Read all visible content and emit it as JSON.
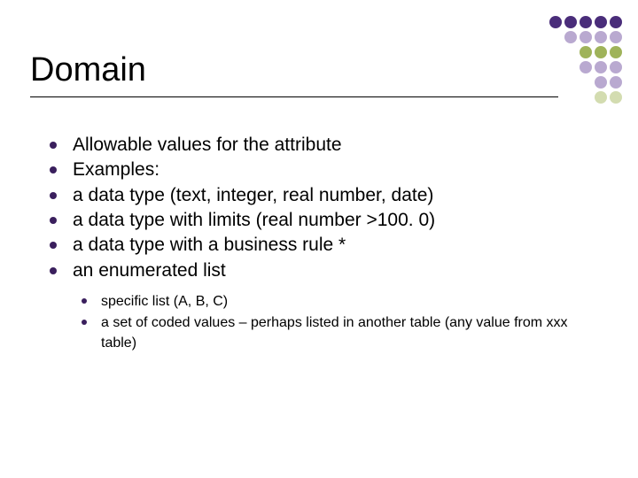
{
  "title": "Domain",
  "bullets": [
    "Allowable values for the attribute",
    "Examples:",
    "a data type (text, integer, real number, date)",
    "a data type with limits  (real number >100. 0)",
    "a data type with a business rule *",
    "an enumerated list"
  ],
  "sub_bullets": [
    "specific list (A, B, C)",
    "a set of coded values – perhaps listed in another table (any value from xxx table)"
  ]
}
